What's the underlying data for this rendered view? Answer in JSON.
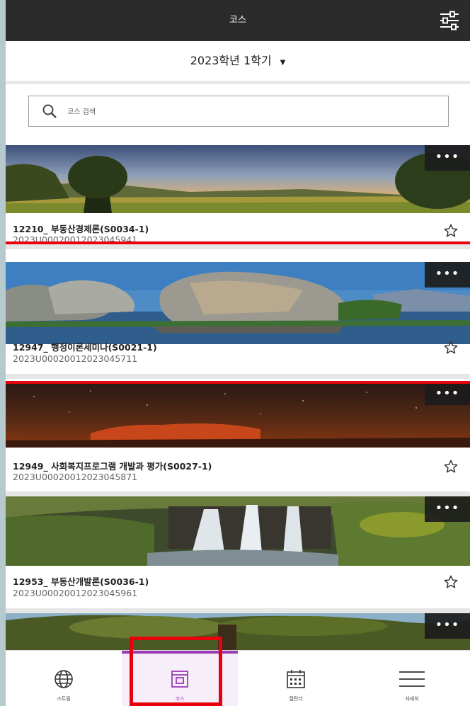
{
  "header": {
    "title": "코스",
    "filter_icon": "sliders-icon"
  },
  "term": {
    "label": "2023학년 1학기",
    "caret": "▼"
  },
  "search": {
    "placeholder": "코스 검색"
  },
  "courses": [
    {
      "name": "12210_ 부동산경제론(S0034-1)",
      "code": "2023U00020012023045941",
      "more": "•••"
    },
    {
      "name": "12947_ 행정이론세미나(S0021-1)",
      "code": "2023U00020012023045711",
      "more": "•••"
    },
    {
      "name": "12949_ 사회복지프로그램 개발과 평가(S0027-1)",
      "code": "2023U00020012023045871",
      "more": "•••"
    },
    {
      "name": "12953_ 부동산개발론(S0036-1)",
      "code": "2023U00020012023045961",
      "more": "•••"
    },
    {
      "more": "•••"
    }
  ],
  "bottom_nav": [
    {
      "label": "스트림",
      "icon": "globe-icon"
    },
    {
      "label": "코스",
      "icon": "course-icon",
      "active": true
    },
    {
      "label": "캘린더",
      "icon": "calendar-icon"
    },
    {
      "label": "자세히",
      "icon": "menu-icon"
    }
  ],
  "colors": {
    "accent": "#9b3bb8",
    "annotation_red": "#e8000c",
    "header_bg": "#2b2b2b"
  }
}
